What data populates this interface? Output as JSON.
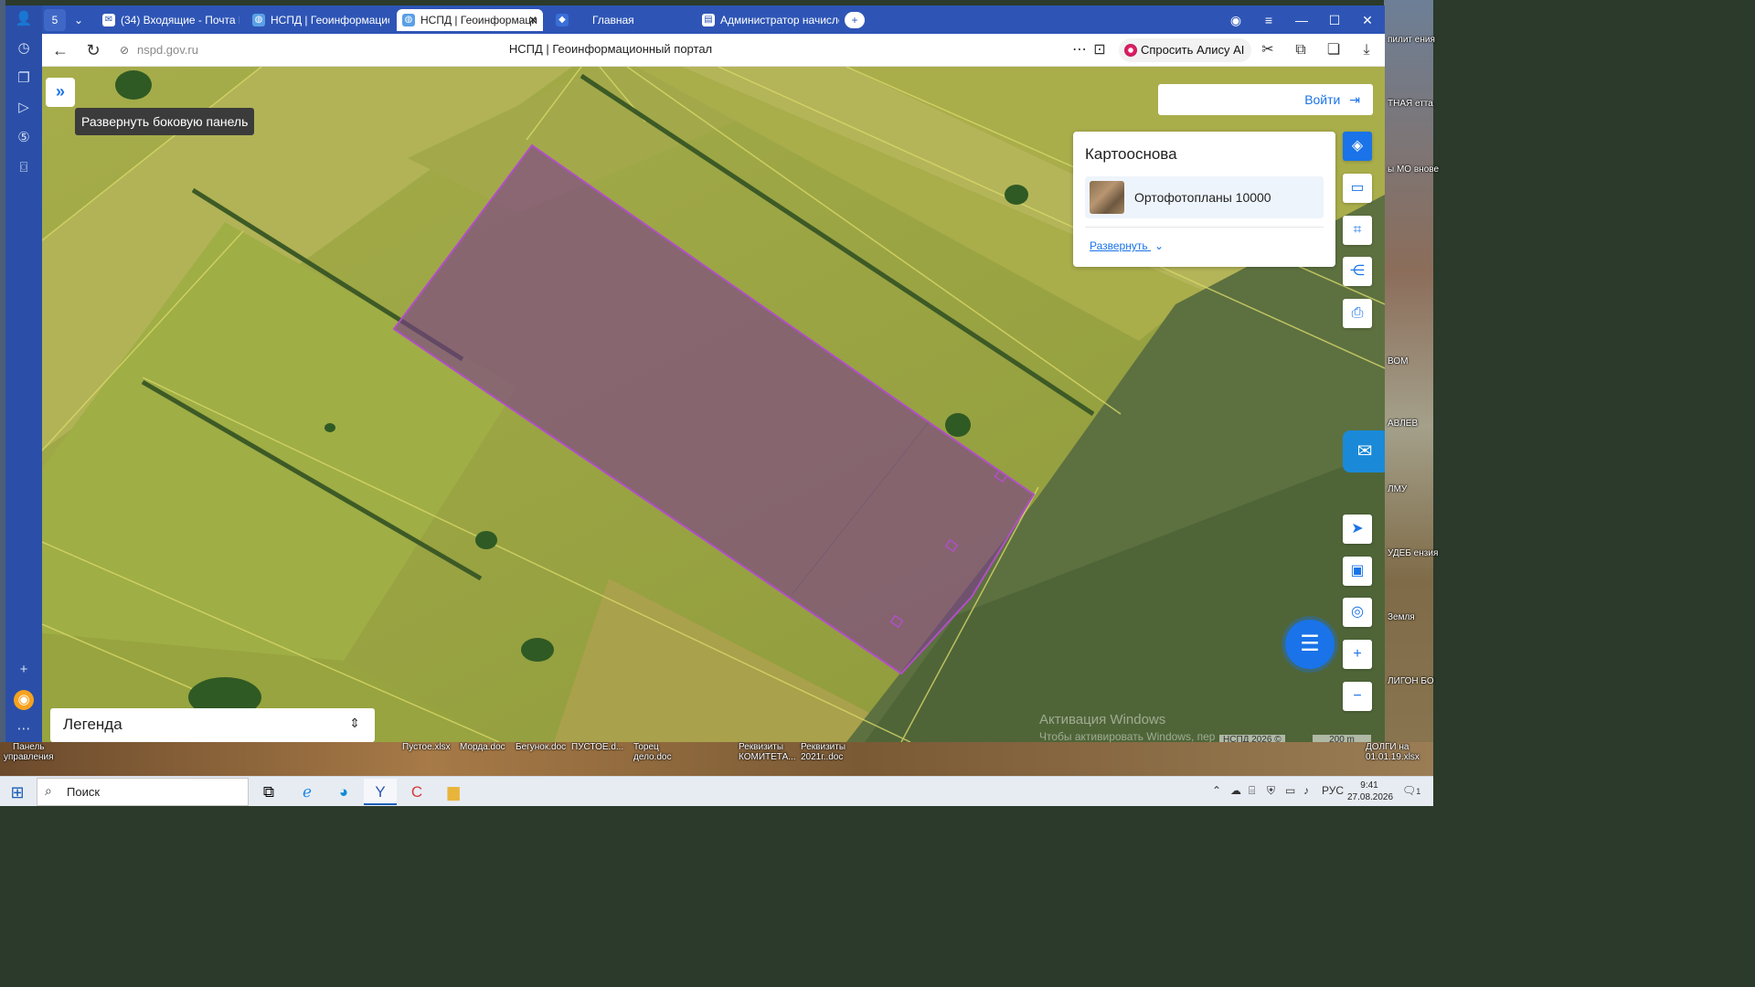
{
  "browser": {
    "tab_counter": "5",
    "tabs": [
      {
        "label": "(34) Входящие - Почта Ма",
        "icon": "mail-icon"
      },
      {
        "label": "НСПД | Геоинформацион",
        "icon": "globe-icon"
      },
      {
        "label": "НСПД | Геоинформаци",
        "icon": "globe-icon",
        "active": true
      },
      {
        "label": "Главная",
        "icon": "app-icon"
      },
      {
        "label": "Администратор начисле",
        "icon": "chart-icon"
      }
    ],
    "close_symbol": "✕",
    "url": "nspd.gov.ru",
    "page_title": "НСПД | Геоинформационный портал",
    "alisa_label": "Спросить Алису AI"
  },
  "map": {
    "sidebar_tooltip": "Развернуть боковую панель",
    "login_label": "Войти",
    "basemap": {
      "title": "Картооснова",
      "selected_layer": "Ортофотопланы 10000",
      "expand_label": "Развернуть"
    },
    "legend_label": "Легенда",
    "windows_watermark_title": "Активация Windows",
    "windows_watermark_text": "Чтобы активировать Windows, пер",
    "copyright": "НСПД 2026 ©",
    "scale_label": "200 m",
    "parcel_outline_color": "#b14fc5"
  },
  "desktop": {
    "bottom_labels": [
      "Панель\nуправления",
      "Пустое.xlsx",
      "Морда.doc",
      "Бегунок.doc",
      "ПУСТОЕ.d...",
      "Торец\nдело.doc",
      "Реквизиты\nКОМИТЕТА...",
      "Реквизиты\n2021г..doc",
      "ДОЛГИ на\n01.01.19.xlsx"
    ],
    "right_labels": [
      "пилит\nения",
      "ТНАЯ\nетта",
      "ы МО\nвнове",
      "ВОМ",
      "АВЛЕВ",
      "ЛМУ",
      "УДЕБ\nензия",
      "Земля",
      "ЛИГОН\nБО"
    ]
  },
  "taskbar": {
    "search_label": "Поиск",
    "lang": "РУС",
    "time": "9:41",
    "date": "27.08.2026",
    "notifications": "1"
  }
}
